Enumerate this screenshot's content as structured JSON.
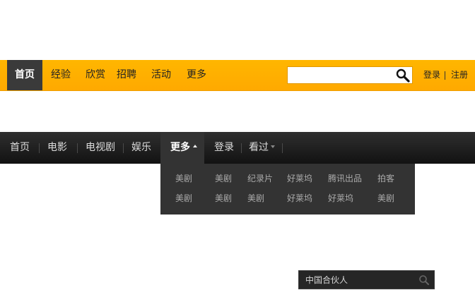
{
  "nav_orange": {
    "items": [
      "首页",
      "经验",
      "欣赏",
      "招聘",
      "活动",
      "更多"
    ],
    "search_value": "",
    "login": "登录",
    "register": "注册",
    "colors": {
      "bar": "#ffae00",
      "active_bg": "#3a3a3a"
    }
  },
  "nav_dark": {
    "items": [
      "首页",
      "电影",
      "电视剧",
      "娱乐",
      "更多",
      "登录",
      "看过"
    ],
    "search_placeholder": "中国合伙人",
    "colors": {
      "bar": "#1e1e1e",
      "dropdown_bg": "#333333"
    }
  },
  "dropdown": {
    "rows": [
      [
        "美剧",
        "美剧",
        "纪录片",
        "好莱坞",
        "腾讯出品",
        "拍客"
      ],
      [
        "美剧",
        "美剧",
        "美剧",
        "好莱坞",
        "好莱坞",
        "美剧"
      ]
    ]
  },
  "icons": {
    "orange_search": "search-icon",
    "dark_search": "search-icon"
  }
}
